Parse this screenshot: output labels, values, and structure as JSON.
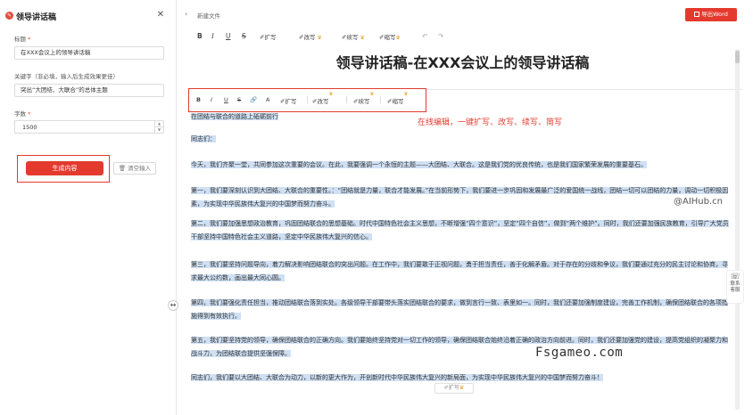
{
  "panel": {
    "logo": "✎",
    "title": "领导讲话稿",
    "close": "✕",
    "title_label": "标题",
    "title_value": "在XXX会议上的领导讲话稿",
    "keywords_label": "关键字（非必填，输入后生成效果更佳）",
    "keywords_value": "突出“大团结、大联合”的总体主题",
    "wordcount_label": "字数",
    "wordcount_value": "1500",
    "generate_label": "生成内容",
    "clear_label": "清空输入",
    "required_mark": "*"
  },
  "header": {
    "back": "‹",
    "doc_name": "新建文件",
    "export_label": "导出Word"
  },
  "toolbar": {
    "bold": "B",
    "italic": "I",
    "underline": "U",
    "strike": "S",
    "expand": "扩写",
    "rewrite": "改写",
    "continue": "续写",
    "shorten": "缩写",
    "undo": "↶",
    "redo": "↷",
    "crown": "♛"
  },
  "float_toolbar": {
    "bold": "B",
    "italic": "I",
    "underline": "U",
    "strike": "S",
    "link": "🔗",
    "font_color": "A",
    "expand": "扩写",
    "rewrite": "改写",
    "continue": "续写",
    "shorten": "缩写",
    "crown": "♛"
  },
  "document": {
    "title": "领导讲话稿-在XXX会议上的领导讲话稿",
    "p1": "在团结与联合的道路上砥砺前行",
    "p2": "同志们：",
    "p3": "今天，我们齐聚一堂，共同参加这次重要的会议。在此，我要强调一个永恒的主题——大团结、大联合。这是我们党的优良传统，也是我们国家繁荣发展的重要基石。",
    "p4": "第一，我们要深刻认识到大团结、大联合的重要性。：“团结就是力量，联合才能发展。”在当前形势下，我们要进一步巩固和发展最广泛的爱国统一战线，团结一切可以团结的力量，调动一切积极因素，为实现中华民族伟大复兴的中国梦而努力奋斗。",
    "p5": "第二，我们要加强思想政治教育，巩固团结联合的思想基础。时代中国特色社会主义思想，不断增强“四个意识”，坚定“四个自信”，做到“两个维护”。同时，我们还要加强民族教育，引导广大党员干部坚持中国特色社会主义道路，坚定中华民族伟大复兴的信心。",
    "p6": "第三，我们要坚持问题导向，着力解决影响团结联合的突出问题。在工作中，我们要敢于正视问题，勇于担当责任，善于化解矛盾。对于存在的分歧和争议，我们要通过充分的民主讨论和协商，寻求最大公约数，画出最大同心圆。",
    "p7": "第四，我们要强化责任担当，推动团结联合落到实处。各级领导干部要带头落实团结联合的要求，做到言行一致、表里如一。同时，我们还要加强制度建设，完善工作机制，确保团结联合的各项措施得到有效执行。",
    "p8": "第五，我们要坚持党的领导，确保团结联合的正确方向。我们要始终坚持党对一切工作的领导，确保团结联合始终沿着正确的政治方向前进。同时，我们还要加强党的建设，提高党组织的凝聚力和战斗力，为团结联合提供坚强保障。",
    "p9": "同志们，我们要以大团结、大联合为动力，以新的更大作为，开创新时代中华民族伟大复兴的新局面，为实现中华民族伟大复兴的中国梦而努力奋斗！"
  },
  "annotation": "在线编辑，一键扩写、改写、续写、简写",
  "watermark1": "@AIHub.cn",
  "watermark2": "Fsgameo.com",
  "bottom_float": "扩写",
  "service": {
    "icon": "☏",
    "line1": "联系",
    "line2": "客服"
  },
  "drag_icon": "↔"
}
